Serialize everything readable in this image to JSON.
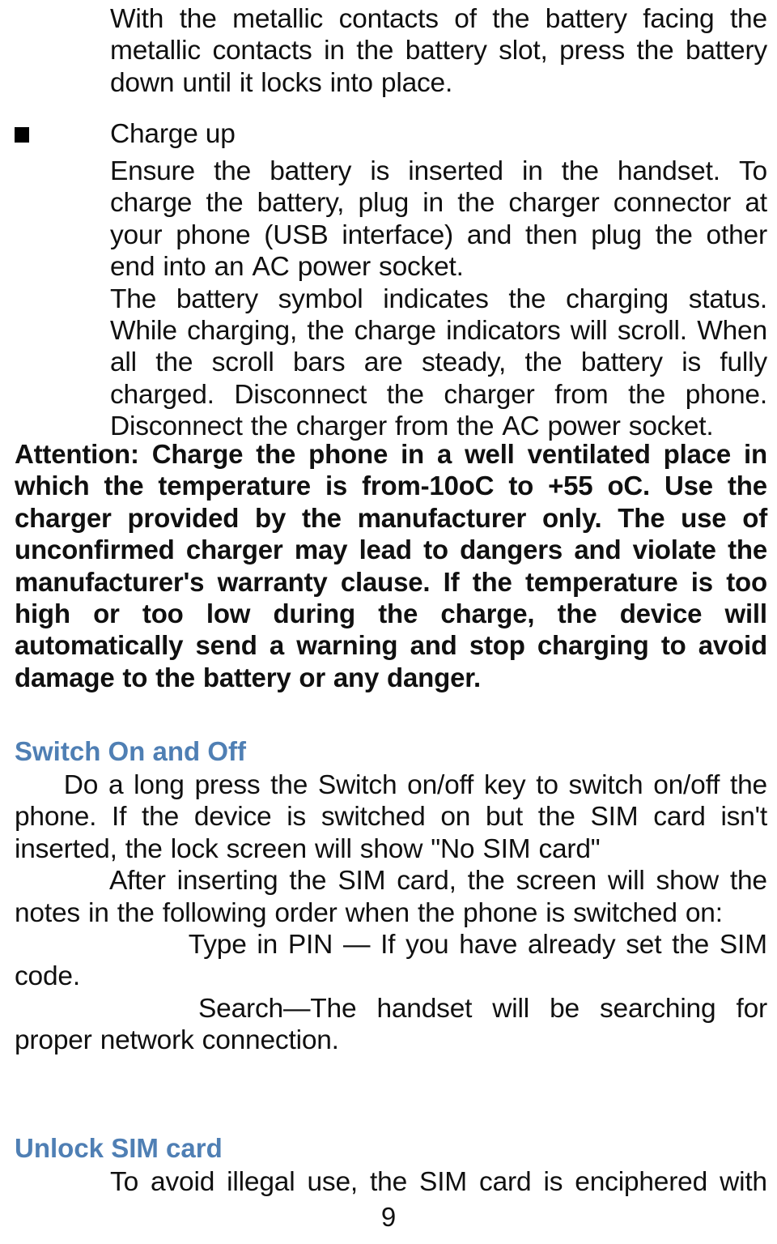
{
  "document": {
    "type": "mobile-phone-user-manual",
    "page_number": "9",
    "text_color": "#101010",
    "heading_color": "#4f7fb4",
    "background_color": "#ffffff"
  },
  "paragraph_intro": {
    "name": "battery-insertion-continuation",
    "lines": [
      "With the metallic contacts of the battery facing the",
      "metallic contacts in the battery slot, press the battery",
      "down until it locks into place."
    ]
  },
  "section_charge_up": {
    "bullet": "filled-square",
    "title": "Charge up",
    "lines": [
      "Ensure the battery is inserted in the handset. To",
      "charge the battery, plug in the charger connector at",
      "your phone (USB interface) and then plug the other",
      "end into an AC power socket.",
      "The battery symbol indicates the charging status.",
      "While charging, the charge indicators will scroll. When",
      "all the scroll bars are steady, the battery is fully",
      "charged. Disconnect the charger from the phone.",
      "Disconnect the charger from the AC power socket."
    ]
  },
  "attention_block": {
    "lines": [
      "Attention: Charge the phone in a well ventilated place in",
      "which the temperature is from-10oC to +55 oC. Use the",
      "charger provided by the manufacturer only. The use of",
      "unconfirmed charger may lead to dangers and violate the",
      "manufacturer's warranty clause. If the temperature is too",
      "high or too low during the charge, the device will",
      "automatically send a warning and stop charging to avoid",
      "damage to the battery or any danger."
    ]
  },
  "section_switch": {
    "heading": "Switch On and Off",
    "lines": [
      "Do a long press the Switch on/off key to switch on/off the",
      "phone. If the device is switched on but the SIM card isn't",
      "inserted, the lock screen will show \"No SIM card\"",
      "After inserting the SIM card, the screen will show the",
      "notes in the following order when the phone is switched on:",
      "Type in PIN — If you have already set the SIM",
      "code.",
      "Search—The handset will be searching for",
      "proper network connection."
    ]
  },
  "section_unlock": {
    "heading": "Unlock SIM card",
    "lines": [
      "To avoid illegal use, the SIM card is enciphered with"
    ]
  },
  "footer": {
    "page_number": "9"
  }
}
